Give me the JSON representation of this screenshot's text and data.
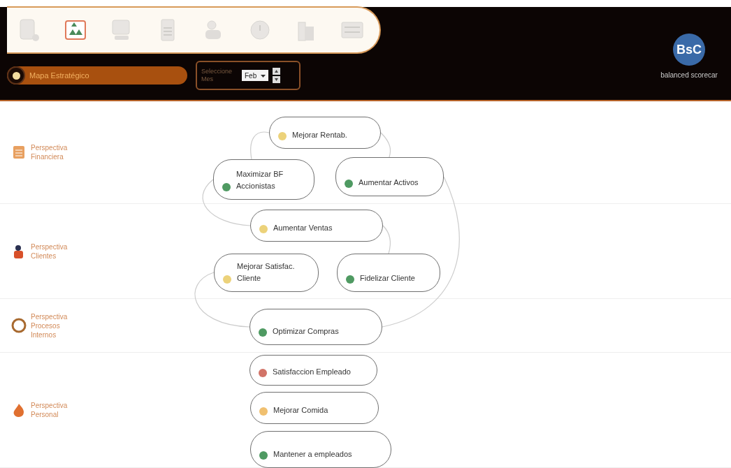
{
  "toolbar": {
    "tools": [
      {
        "selected": false
      },
      {
        "selected": true
      },
      {
        "selected": false
      },
      {
        "selected": false
      },
      {
        "selected": false
      },
      {
        "selected": false
      },
      {
        "selected": false
      },
      {
        "selected": false
      }
    ]
  },
  "view_tab": {
    "label": "Mapa Estratégico",
    "selected": true
  },
  "month_selector": {
    "label": "Seleccione Mes",
    "value": "Feb"
  },
  "logo": {
    "mark": "BsC",
    "caption": "balanced scorecar"
  },
  "perspectives": [
    {
      "label": "Perspectiva Financiera"
    },
    {
      "label": "Perspectiva Clientes"
    },
    {
      "label": "Perspectiva Procesos Internos"
    },
    {
      "label": "Perspectiva Personal"
    }
  ],
  "objectives": [
    {
      "label": "Mejorar Rentab.",
      "color": "#ecd27a"
    },
    {
      "label": "Maximizar BF Accionistas",
      "color": "#4f9a62"
    },
    {
      "label": "Aumentar Activos",
      "color": "#4f9a62"
    },
    {
      "label": "Aumentar Ventas",
      "color": "#ecd27a"
    },
    {
      "label": "Mejorar Satisfac. Cliente",
      "color": "#ecd27a"
    },
    {
      "label": "Fidelizar Cliente",
      "color": "#4f9a62"
    },
    {
      "label": "Optimizar Compras",
      "color": "#4f9a62"
    },
    {
      "label": "Satisfaccion Empleado",
      "color": "#d27468"
    },
    {
      "label": "Mejorar Comida",
      "color": "#f0c070"
    },
    {
      "label": "Mantener a empleados",
      "color": "#4f9a62"
    }
  ]
}
